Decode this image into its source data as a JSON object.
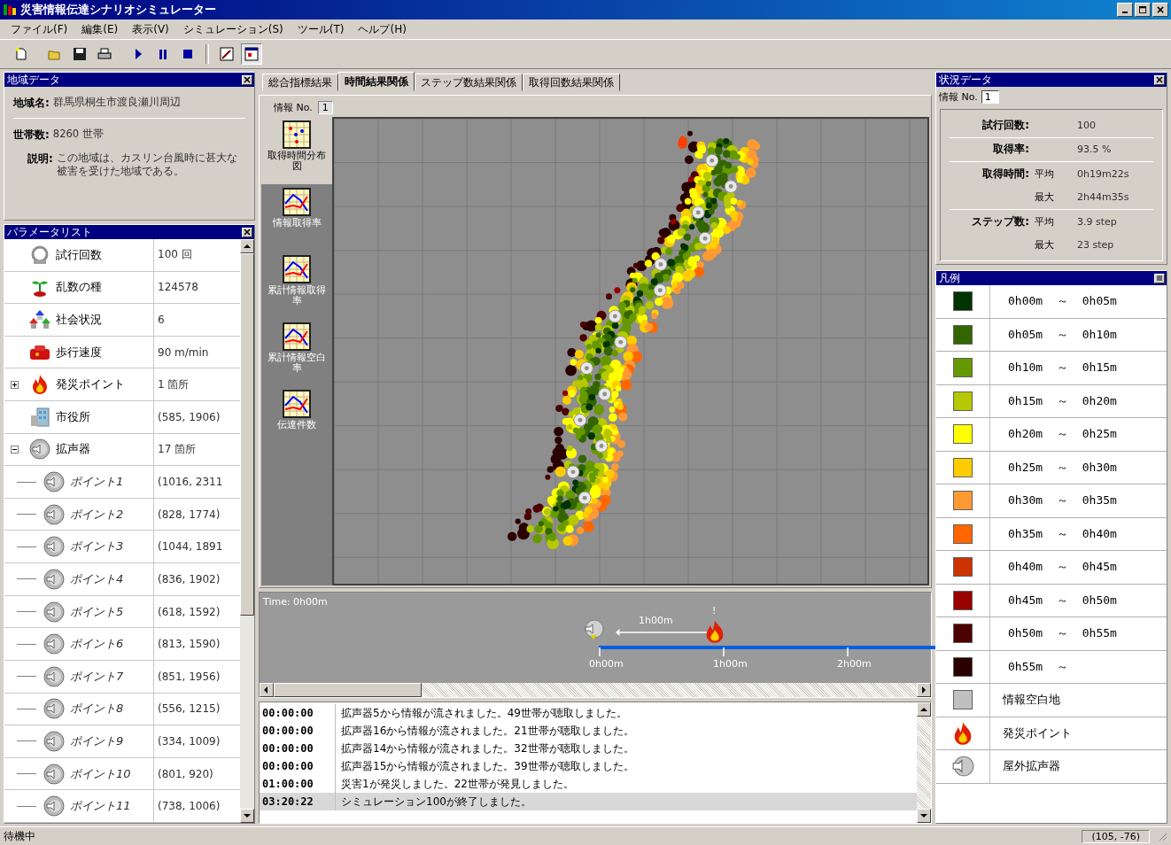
{
  "window": {
    "title": "災害情報伝達シナリオシミュレーター"
  },
  "menu": [
    "ファイル(F)",
    "編集(E)",
    "表示(V)",
    "シミュレーション(S)",
    "ツール(T)",
    "ヘルプ(H)"
  ],
  "area_panel": {
    "title": "地域データ",
    "fields": [
      {
        "label": "地域名:",
        "value": "群馬県桐生市渡良瀬川周辺"
      },
      {
        "label": "世帯数:",
        "value": "8260 世帯"
      },
      {
        "label": "説明:",
        "value": "この地域は、カスリン台風時に甚大な被害を受けた地域である。"
      }
    ]
  },
  "param_panel": {
    "title": "パラメータリスト",
    "rows": [
      {
        "kind": "trial",
        "label": "試行回数",
        "value": "100 回"
      },
      {
        "kind": "seed",
        "label": "乱数の種",
        "value": "124578"
      },
      {
        "kind": "society",
        "label": "社会状況",
        "value": "6"
      },
      {
        "kind": "walk",
        "label": "歩行速度",
        "value": "90 m/min"
      },
      {
        "kind": "fire",
        "label": "発災ポイント",
        "value": "1 箇所",
        "expanded": false
      },
      {
        "kind": "office",
        "label": "市役所",
        "value": "(585, 1906)"
      },
      {
        "kind": "speaker",
        "label": "拡声器",
        "value": "17 箇所",
        "expanded": true,
        "children": [
          {
            "label": "ポイント1",
            "value": "(1016, 2311"
          },
          {
            "label": "ポイント2",
            "value": "(828, 1774)"
          },
          {
            "label": "ポイント3",
            "value": "(1044, 1891"
          },
          {
            "label": "ポイント4",
            "value": "(836, 1902)"
          },
          {
            "label": "ポイント5",
            "value": "(618, 1592)"
          },
          {
            "label": "ポイント6",
            "value": "(813, 1590)"
          },
          {
            "label": "ポイント7",
            "value": "(851, 1956)"
          },
          {
            "label": "ポイント8",
            "value": "(556, 1215)"
          },
          {
            "label": "ポイント9",
            "value": "(334, 1009)"
          },
          {
            "label": "ポイント10",
            "value": "(801, 920)"
          },
          {
            "label": "ポイント11",
            "value": "(738, 1006)"
          }
        ]
      }
    ]
  },
  "result_tabs": [
    {
      "label": "総合指標結果",
      "selected": false
    },
    {
      "label": "時間結果関係",
      "selected": true
    },
    {
      "label": "ステップ数結果関係",
      "selected": false
    },
    {
      "label": "取得回数結果関係",
      "selected": false
    }
  ],
  "info_no": {
    "label": "情報 No.",
    "value": "1"
  },
  "graph_buttons": [
    {
      "kind": "scatter",
      "label": "取得時間分布図",
      "selected": true
    },
    {
      "kind": "line",
      "label": "情報取得率",
      "selected": false
    },
    {
      "kind": "line",
      "label": "累計情報取得率",
      "selected": false
    },
    {
      "kind": "line",
      "label": "累計情報空白率",
      "selected": false
    },
    {
      "kind": "line",
      "label": "伝達件数",
      "selected": false
    }
  ],
  "timeline": {
    "time": "Time: 0h00m",
    "interval": "1h00m",
    "alert": "!",
    "ticks": [
      "0h00m",
      "1h00m",
      "2h00m"
    ]
  },
  "log": [
    {
      "time": "00:00:00",
      "message": "拡声器5から情報が流されました。49世帯が聴取しました。",
      "selected": false
    },
    {
      "time": "00:00:00",
      "message": "拡声器16から情報が流されました。21世帯が聴取しました。",
      "selected": false
    },
    {
      "time": "00:00:00",
      "message": "拡声器14から情報が流されました。32世帯が聴取しました。",
      "selected": false
    },
    {
      "time": "00:00:00",
      "message": "拡声器15から情報が流されました。39世帯が聴取しました。",
      "selected": false
    },
    {
      "time": "01:00:00",
      "message": "災害1が発災しました。22世帯が発見しました。",
      "selected": false
    },
    {
      "time": "03:20:22",
      "message": "シミュレーション100が終了しました。",
      "selected": true
    }
  ],
  "status_panel": {
    "title": "状況データ",
    "info_no": {
      "label": "情報 No.",
      "value": "1"
    },
    "rows": [
      {
        "label": "試行回数:",
        "value": "100"
      },
      {
        "label": "取得率:",
        "value": "93.5 %"
      },
      {
        "label": "取得時間:",
        "sub": "平均",
        "value": "0h19m22s"
      },
      {
        "sub": "最大",
        "value": "2h44m35s"
      },
      {
        "label": "ステップ数:",
        "sub": "平均",
        "value": "3.9 step"
      },
      {
        "sub": "最大",
        "value": "23 step"
      }
    ]
  },
  "legend": {
    "title": "凡例",
    "items": [
      {
        "kind": "swatch",
        "color": "#003300",
        "label": "0h00m ～ 0h05m"
      },
      {
        "kind": "swatch",
        "color": "#336600",
        "label": "0h05m ～ 0h10m"
      },
      {
        "kind": "swatch",
        "color": "#669900",
        "label": "0h10m ～ 0h15m"
      },
      {
        "kind": "swatch",
        "color": "#b5c800",
        "label": "0h15m ～ 0h20m"
      },
      {
        "kind": "swatch",
        "color": "#ffff00",
        "label": "0h20m ～ 0h25m"
      },
      {
        "kind": "swatch",
        "color": "#ffcc00",
        "label": "0h25m ～ 0h30m"
      },
      {
        "kind": "swatch",
        "color": "#ff9933",
        "label": "0h30m ～ 0h35m"
      },
      {
        "kind": "swatch",
        "color": "#ff6600",
        "label": "0h35m ～ 0h40m"
      },
      {
        "kind": "swatch",
        "color": "#cc3300",
        "label": "0h40m ～ 0h45m"
      },
      {
        "kind": "swatch",
        "color": "#990000",
        "label": "0h45m ～ 0h50m"
      },
      {
        "kind": "swatch",
        "color": "#4d0000",
        "label": "0h50m ～ 0h55m"
      },
      {
        "kind": "swatch",
        "color": "#2a0000",
        "label": "0h55m ～"
      },
      {
        "kind": "swatch",
        "color": "#c0c0c0",
        "label": "情報空白地"
      },
      {
        "kind": "fire",
        "label": "発災ポイント"
      },
      {
        "kind": "speaker",
        "label": "屋外拡声器"
      }
    ]
  },
  "status_bar": {
    "message": "待機中",
    "coords": "(105, -76)"
  }
}
